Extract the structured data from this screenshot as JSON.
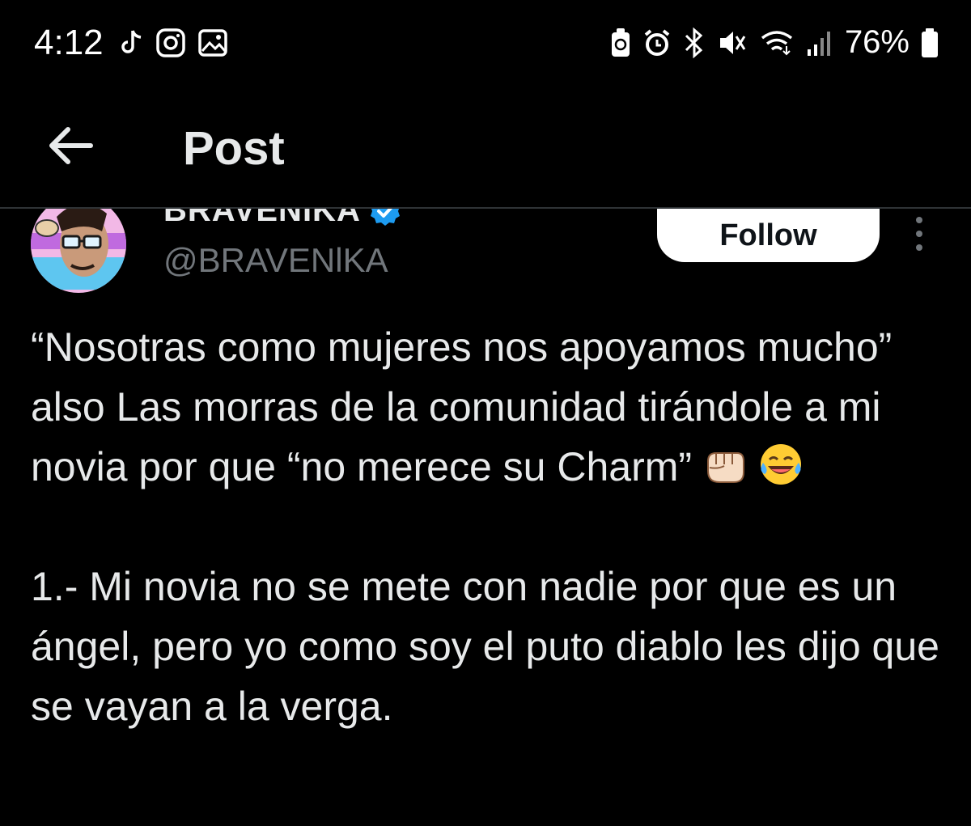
{
  "status_bar": {
    "time": "4:12",
    "battery_percent": "76%",
    "left_icons": [
      "tiktok-icon",
      "instagram-icon",
      "gallery-icon"
    ],
    "right_icons": [
      "battery-saver-icon",
      "alarm-icon",
      "bluetooth-icon",
      "mute-icon",
      "wifi-icon",
      "signal-icon",
      "battery-icon"
    ]
  },
  "header": {
    "title": "Post",
    "back_icon": "back-arrow-icon"
  },
  "author": {
    "display_name": "BRAVENIKA",
    "handle": "@BRAVENlKA",
    "verified": true,
    "follow_label": "Follow",
    "more_icon": "more-vertical-icon"
  },
  "post": {
    "paragraph_1": "“Nosotras como mujeres nos apoyamos mucho” also Las morras de la comunidad tirándole a mi novia por que “no merece su Charm”",
    "paragraph_1_emojis": [
      "fist-emoji",
      "laughing-tears-emoji"
    ],
    "paragraph_2": "1.- Mi novia no se mete con nadie por que es un ángel, pero yo como soy el puto diablo les dijo que se vayan a la verga."
  },
  "colors": {
    "background": "#000000",
    "text": "#e7e9ea",
    "secondary_text": "#71767b",
    "verified": "#1d9bf0",
    "follow_bg": "#ffffff"
  }
}
